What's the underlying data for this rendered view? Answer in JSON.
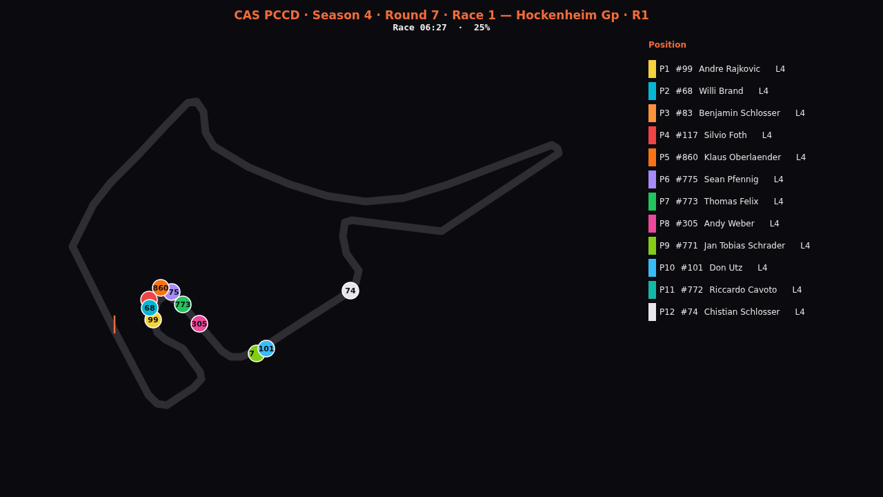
{
  "header": {
    "title": "CAS PCCD · Season 4 · Round 7 · Race 1 — Hockenheim Gp · R1",
    "subtitle": "Race 06:27  ·  25%"
  },
  "legend": {
    "title": "Position",
    "rows": [
      {
        "position": "P1",
        "number": "#99",
        "name": "Andre Rajkovic",
        "lap": "L4",
        "color": "#f5d33f"
      },
      {
        "position": "P2",
        "number": "#68",
        "name": "Willi Brand",
        "lap": "L4",
        "color": "#06b6d4"
      },
      {
        "position": "P3",
        "number": "#83",
        "name": "Benjamin Schlosser",
        "lap": "L4",
        "color": "#fb923c"
      },
      {
        "position": "P4",
        "number": "#117",
        "name": "Silvio Foth",
        "lap": "L4",
        "color": "#ef4444"
      },
      {
        "position": "P5",
        "number": "#860",
        "name": "Klaus Oberlaender",
        "lap": "L4",
        "color": "#f97316"
      },
      {
        "position": "P6",
        "number": "#775",
        "name": "Sean Pfennig",
        "lap": "L4",
        "color": "#a78bfa"
      },
      {
        "position": "P7",
        "number": "#773",
        "name": "Thomas Felix",
        "lap": "L4",
        "color": "#22c55e"
      },
      {
        "position": "P8",
        "number": "#305",
        "name": "Andy Weber",
        "lap": "L4",
        "color": "#ec4899"
      },
      {
        "position": "P9",
        "number": "#771",
        "name": "Jan Tobias Schrader",
        "lap": "L4",
        "color": "#84cc16"
      },
      {
        "position": "P10",
        "number": "#101",
        "name": "Don Utz",
        "lap": "L4",
        "color": "#38bdf8"
      },
      {
        "position": "P11",
        "number": "#772",
        "name": "Riccardo Cavoto",
        "lap": "L4",
        "color": "#14b8a6"
      },
      {
        "position": "P12",
        "number": "#74",
        "name": "Chistian Schlosser",
        "lap": "L4",
        "color": "#e5e7eb"
      }
    ]
  },
  "markers": [
    {
      "label": "75",
      "color": "#a78bfa"
    },
    {
      "label": "860",
      "color": "#f97316"
    },
    {
      "color": "#ef4444"
    },
    {
      "label": "99",
      "color": "#f5d33f"
    },
    {
      "label": "68",
      "color": "#06b6d4"
    },
    {
      "label": "773",
      "color": "#22c55e"
    },
    {
      "label": "305",
      "color": "#ec4899"
    },
    {
      "label": "7",
      "color": "#84cc16"
    },
    {
      "label": "101",
      "color": "#38bdf8"
    },
    {
      "label": "74",
      "color": "#e5e7eb"
    }
  ]
}
